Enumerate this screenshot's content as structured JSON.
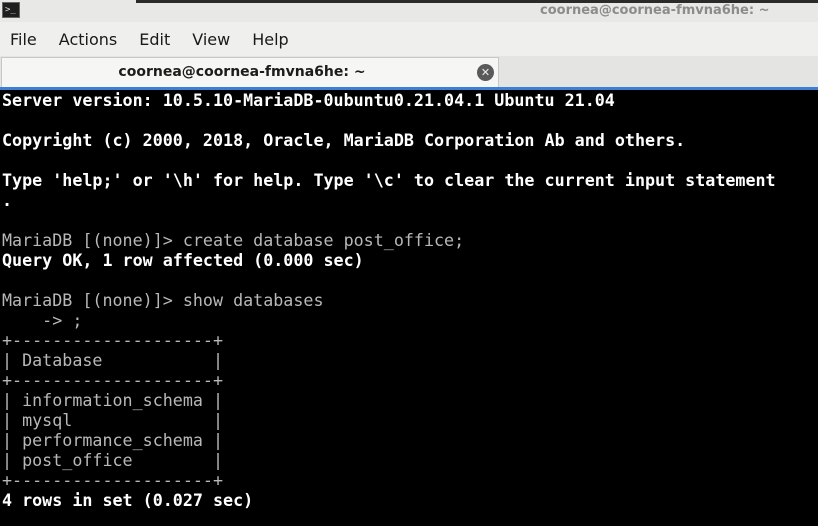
{
  "window": {
    "icon_glyph": ">_",
    "title": "coornea@coornea-fmvna6he: ~"
  },
  "menu": [
    "File",
    "Actions",
    "Edit",
    "View",
    "Help"
  ],
  "tab": {
    "label": "coornea@coornea-fmvna6he: ~",
    "close_glyph": "✕"
  },
  "terminal": {
    "lines": [
      "Server version: 10.5.10-MariaDB-0ubuntu0.21.04.1 Ubuntu 21.04",
      "",
      "Copyright (c) 2000, 2018, Oracle, MariaDB Corporation Ab and others.",
      "",
      "Type 'help;' or '\\h' for help. Type '\\c' to clear the current input statement",
      ".",
      "",
      "MariaDB [(none)]> create database post_office;",
      "Query OK, 1 row affected (0.000 sec)",
      "",
      "MariaDB [(none)]> show databases",
      "    -> ;",
      "+--------------------+",
      "| Database           |",
      "+--------------------+",
      "| information_schema |",
      "| mysql              |",
      "| performance_schema |",
      "| post_office        |",
      "+--------------------+",
      "4 rows in set (0.027 sec)"
    ]
  }
}
